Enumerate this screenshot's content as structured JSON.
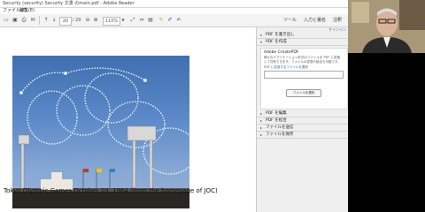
{
  "window": {
    "title": "Security (security) Security 文書 のmain.pdf - Adobe Reader"
  },
  "menu": {
    "items": [
      "ファイル(F)",
      "編集(E)",
      "表示(V)",
      "ウィンドウ(W)",
      "ヘルプ(H)"
    ]
  },
  "toolbar": {
    "page_current": "20",
    "page_total": "/ 29",
    "zoom": "110%",
    "right_tools": "ツール",
    "right_sign": "入力と署名",
    "right_comment": "注釈"
  },
  "panel": {
    "signin": "サインイン",
    "sections_top": [
      "PDF を書き出し",
      "PDF を作成"
    ],
    "service_name": "Adobe CreatePDF",
    "service_desc": "様々なアプリケーション形式のファイルを PDF に変換して共有できます。ファイルの変換や結合も可能です。",
    "select_link": "PDF に変換するファイルを選択",
    "select_button": "ファイルを選択",
    "sections_bottom": [
      "PDF を編集",
      "PDF を結合",
      "ファイルを送信",
      "ファイルを保存"
    ]
  },
  "document": {
    "caption": "Tokyo Olympic Games October 10, 1964    (from the homepage of JOC)"
  },
  "colors": {
    "sky": "#5a88c8",
    "panel_bg": "#efefef",
    "link": "#2b6cb0",
    "desktop": "#000000"
  }
}
